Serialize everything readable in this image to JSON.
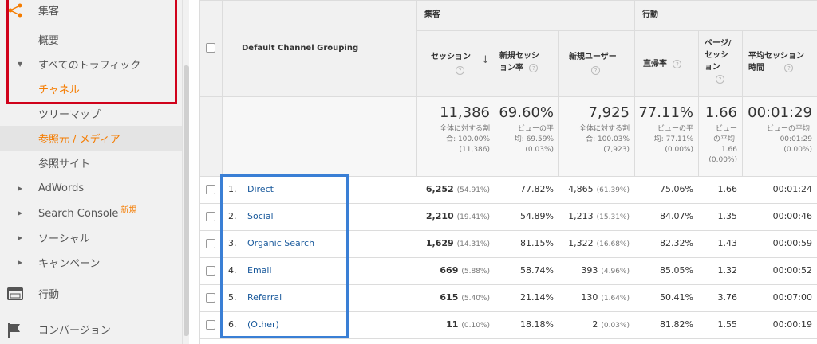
{
  "sidebar": {
    "items": [
      {
        "label": "集客",
        "arrow": ""
      },
      {
        "label": "概要",
        "arrow": ""
      },
      {
        "label": "すべてのトラフィック",
        "arrow": "▼"
      },
      {
        "label": "チャネル",
        "arrow": ""
      },
      {
        "label": "ツリーマップ",
        "arrow": ""
      },
      {
        "label": "参照元 / メディア",
        "arrow": ""
      },
      {
        "label": "参照サイト",
        "arrow": ""
      },
      {
        "label": "AdWords",
        "arrow": "▶"
      },
      {
        "label": "Search Console",
        "arrow": "▶",
        "badge": "新規"
      },
      {
        "label": "ソーシャル",
        "arrow": "▶"
      },
      {
        "label": "キャンペーン",
        "arrow": "▶"
      },
      {
        "label": "行動",
        "arrow": ""
      },
      {
        "label": "コンバージョン",
        "arrow": ""
      }
    ],
    "accent_color": "#f57c00"
  },
  "table": {
    "dimension_header": "Default Channel Grouping",
    "group_headers": {
      "acquisition": "集客",
      "behavior": "行動"
    },
    "columns": {
      "sessions": "セッション",
      "new_session_rate": [
        "新規セッシ",
        "ョン率"
      ],
      "new_users": "新規ユーザー",
      "bounce_rate": "直帰率",
      "pages_per_session": [
        "ページ/",
        "セッシ",
        "ョン"
      ],
      "avg_duration": [
        "平均セッション",
        "時間"
      ]
    },
    "help_glyph": "?",
    "sort_glyph": "↓",
    "totals": {
      "sessions": {
        "value": "11,386",
        "sub": [
          "全体に対する割",
          "合: 100.00%",
          "(11,386)"
        ]
      },
      "new_session_rate": {
        "value": "69.60%",
        "sub": [
          "ビューの平",
          "均: 69.59%",
          "(0.03%)"
        ]
      },
      "new_users": {
        "value": "7,925",
        "sub": [
          "全体に対する割",
          "合: 100.03%",
          "(7,923)"
        ]
      },
      "bounce_rate": {
        "value": "77.11%",
        "sub": [
          "ビューの平",
          "均: 77.11%",
          "(0.00%)"
        ]
      },
      "pages_per_session": {
        "value": "1.66",
        "sub": [
          "ビュー",
          "の平均:",
          "1.66",
          "(0.00%)"
        ]
      },
      "avg_duration": {
        "value": "00:01:29",
        "sub": [
          "ビューの平均:",
          "00:01:29",
          "(0.00%)"
        ]
      }
    },
    "rows": [
      {
        "num": "1.",
        "channel": "Direct",
        "sessions": "6,252",
        "sessions_pct": "(54.91%)",
        "new_session_rate": "77.82%",
        "new_users": "4,865",
        "new_users_pct": "(61.39%)",
        "bounce_rate": "75.06%",
        "pages_per_session": "1.66",
        "avg_duration": "00:01:24"
      },
      {
        "num": "2.",
        "channel": "Social",
        "sessions": "2,210",
        "sessions_pct": "(19.41%)",
        "new_session_rate": "54.89%",
        "new_users": "1,213",
        "new_users_pct": "(15.31%)",
        "bounce_rate": "84.07%",
        "pages_per_session": "1.35",
        "avg_duration": "00:00:46"
      },
      {
        "num": "3.",
        "channel": "Organic Search",
        "sessions": "1,629",
        "sessions_pct": "(14.31%)",
        "new_session_rate": "81.15%",
        "new_users": "1,322",
        "new_users_pct": "(16.68%)",
        "bounce_rate": "82.32%",
        "pages_per_session": "1.43",
        "avg_duration": "00:00:59"
      },
      {
        "num": "4.",
        "channel": "Email",
        "sessions": "669",
        "sessions_pct": "(5.88%)",
        "new_session_rate": "58.74%",
        "new_users": "393",
        "new_users_pct": "(4.96%)",
        "bounce_rate": "85.05%",
        "pages_per_session": "1.32",
        "avg_duration": "00:00:52"
      },
      {
        "num": "5.",
        "channel": "Referral",
        "sessions": "615",
        "sessions_pct": "(5.40%)",
        "new_session_rate": "21.14%",
        "new_users": "130",
        "new_users_pct": "(1.64%)",
        "bounce_rate": "50.41%",
        "pages_per_session": "3.76",
        "avg_duration": "00:07:00"
      },
      {
        "num": "6.",
        "channel": "(Other)",
        "sessions": "11",
        "sessions_pct": "(0.10%)",
        "new_session_rate": "18.18%",
        "new_users": "2",
        "new_users_pct": "(0.03%)",
        "bounce_rate": "81.82%",
        "pages_per_session": "1.55",
        "avg_duration": "00:00:19"
      }
    ],
    "link_color": "#1a5a9c"
  },
  "annotations": {
    "red_box_color": "#d0021b",
    "blue_box_color": "#3a7fd5"
  }
}
